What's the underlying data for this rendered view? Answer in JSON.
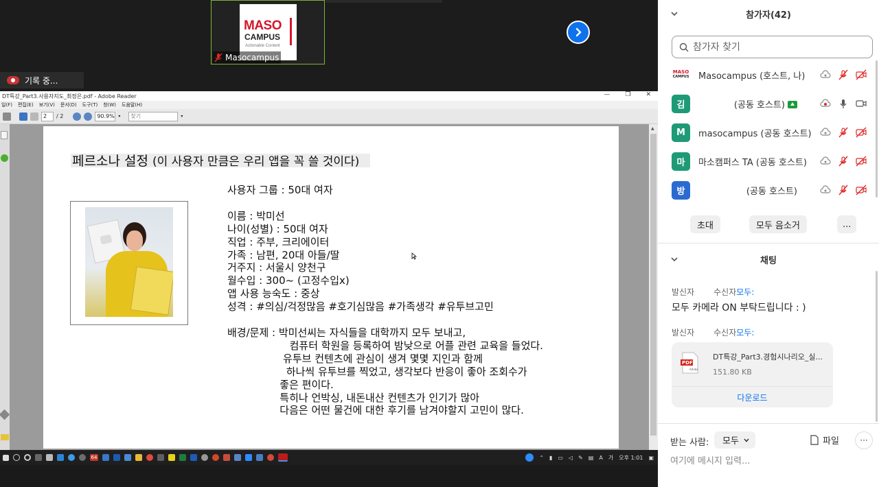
{
  "video": {
    "logo_line1": "MASO",
    "logo_line2": "CAMPUS",
    "logo_line3": "Actionable Content",
    "tile_name": "Masocampus",
    "recording": "기록 중..."
  },
  "reader": {
    "title": "DT특강_Part3.사용자지도_최정은.pdf - Adobe Reader",
    "menu": [
      "일(F)",
      "편집(E)",
      "보기(V)",
      "문서(D)",
      "도구(T)",
      "창(W)",
      "도움말(H)"
    ],
    "page_current": "2",
    "page_total": "/ 2",
    "zoom": "90.9%",
    "find_placeholder": "찾기"
  },
  "slide": {
    "title_main": "페르소나 설정 ",
    "title_sub": "(이 사용자 만큼은 우리 앱을 꼭 쓸 것이다)",
    "info_text": "사용자 그룹 : 50대 여자\n\n이름 : 박미선\n나이(성별) : 50대 여자\n직업 : 주부, 크리에이터\n가족 : 남편, 20대 아들/딸\n거주지 : 서울시 양천구\n월수입 : 300~ (고정수입x)\n앱 사용 능숙도 : 중상\n성격 : #의심/걱정많음 #호기심많음 #가족생각 #유투브고민\n\n배경/문제 : 박미선씨는 자식들을 대학까지 모두 보내고,\n                   컴퓨터 학원을 등록하여 밤낮으로 어플 관련 교육을 들었다.\n                 유투브 컨텐츠에 관심이 생겨 몇몇 지인과 함께\n                  하나씩 유투브를 찍었고, 생각보다 반응이 좋아 조회수가\n                좋은 편이다.\n                특히나 언박싱, 내돈내산 컨텐츠가 인기가 많아\n                다음은 어떤 물건에 대한 후기를 남겨야할지 고민이 많다."
  },
  "taskbar": {
    "time": "오후 1:01",
    "badge": "64"
  },
  "panel": {
    "participants_title": "참가자(42)",
    "search_placeholder": "참가자 찾기",
    "participants": [
      {
        "avatar": "",
        "name": "Masocampus (호스트, 나)",
        "avatar_color": "#ffffff"
      },
      {
        "avatar": "김",
        "name": "(공동 호스트)",
        "avatar_color": "#1e9a76"
      },
      {
        "avatar": "M",
        "name": "masocampus (공동 호스트)",
        "avatar_color": "#1e9a76"
      },
      {
        "avatar": "마",
        "name": "마소캠퍼스 TA (공동 호스트)",
        "avatar_color": "#1e9a76"
      },
      {
        "avatar": "방",
        "name": "(공동 호스트)",
        "avatar_color": "#2a6bd1"
      }
    ],
    "invite_label": "초대",
    "mute_all_label": "모두 음소거",
    "more_label": "...",
    "chat_title": "채팅",
    "msg1": {
      "from": "발신자",
      "to_label": "수신자",
      "to": "모두:",
      "text": "모두 카메라 ON 부탁드립니다 : )"
    },
    "msg2": {
      "from": "발신자",
      "to_label": "수신자",
      "to": "모두:"
    },
    "file": {
      "name": "DT특강_Part3.경험시나리오_실...",
      "size": "151.80 KB",
      "download": "다운로드"
    },
    "compose": {
      "to_label": "받는 사람:",
      "to_value": "모두",
      "file_label": "파일",
      "more": "···",
      "placeholder": "여기에 메시지 입력..."
    },
    "colors": {
      "accent": "#0e72ed",
      "mute_red": "#e02828"
    }
  }
}
